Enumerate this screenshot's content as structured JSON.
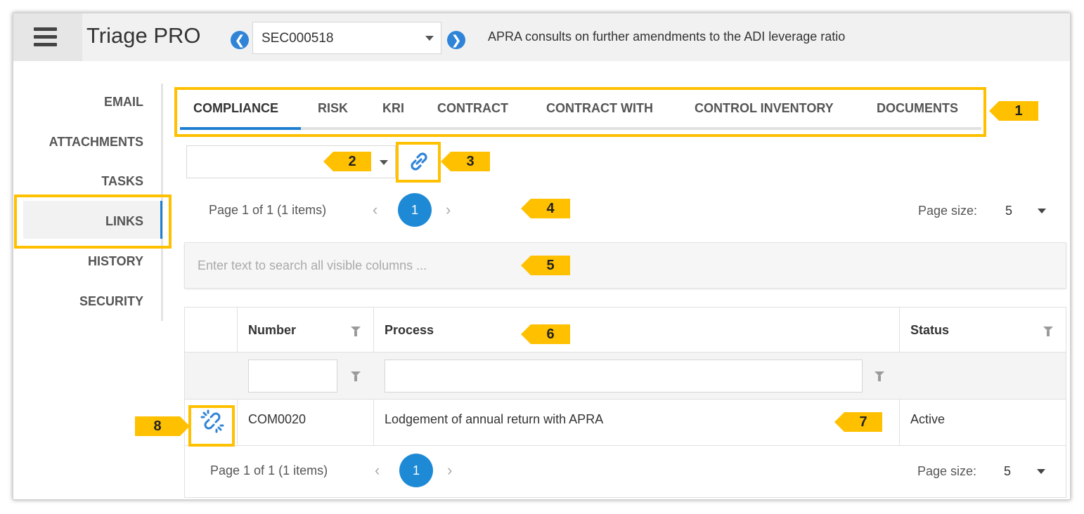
{
  "header": {
    "app_title": "Triage PRO",
    "record_id": "SEC000518",
    "record_title": "APRA consults on further amendments to the ADI leverage ratio",
    "prev_glyph": "❮",
    "next_glyph": "❯"
  },
  "sidebar": {
    "items": [
      {
        "label": "EMAIL"
      },
      {
        "label": "ATTACHMENTS"
      },
      {
        "label": "TASKS"
      },
      {
        "label": "LINKS",
        "active": true
      },
      {
        "label": "HISTORY"
      },
      {
        "label": "SECURITY"
      }
    ]
  },
  "tabs": [
    {
      "label": "COMPLIANCE",
      "active": true
    },
    {
      "label": "RISK"
    },
    {
      "label": "KRI"
    },
    {
      "label": "CONTRACT"
    },
    {
      "label": "CONTRACT WITH"
    },
    {
      "label": "CONTROL INVENTORY"
    },
    {
      "label": "DOCUMENTS"
    }
  ],
  "pager_top": {
    "info": "Page 1 of 1 (1 items)",
    "current_page": "1",
    "page_size_label": "Page size:",
    "page_size": "5"
  },
  "search": {
    "placeholder": "Enter text to search all visible columns ..."
  },
  "grid": {
    "columns": [
      "Number",
      "Process",
      "Status"
    ],
    "rows": [
      {
        "number": "COM0020",
        "process": "Lodgement of annual return with APRA",
        "status": "Active"
      }
    ]
  },
  "pager_bottom": {
    "info": "Page 1 of 1 (1 items)",
    "current_page": "1",
    "page_size_label": "Page size:",
    "page_size": "5"
  },
  "callouts": [
    "1",
    "2",
    "3",
    "4",
    "5",
    "6",
    "7",
    "8"
  ],
  "colors": {
    "accent": "#1e7fd0",
    "highlight": "#ffc000"
  },
  "icons": {
    "menu": "hamburger-menu-icon",
    "prev": "arrow-left-circle-icon",
    "next": "arrow-right-circle-icon",
    "link": "link-icon",
    "unlink": "unlink-icon",
    "filter": "filter-icon"
  }
}
